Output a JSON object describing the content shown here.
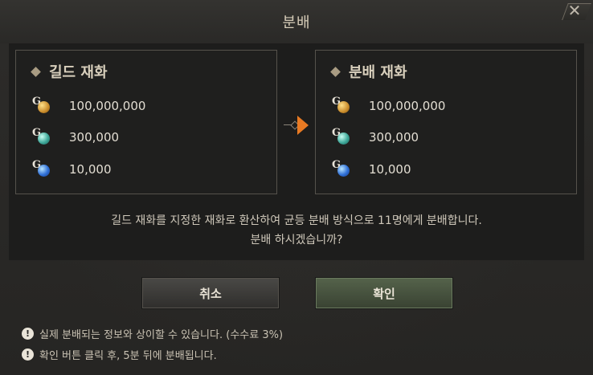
{
  "dialog": {
    "title": "분배",
    "close_label": "✕"
  },
  "guild_currency": {
    "title": "길드 재화",
    "items": [
      {
        "icon": "gold-coin-icon",
        "amount": "100,000,000"
      },
      {
        "icon": "teal-gem-icon",
        "amount": "300,000"
      },
      {
        "icon": "blue-gem-icon",
        "amount": "10,000"
      }
    ]
  },
  "distribute_currency": {
    "title": "분배 재화",
    "items": [
      {
        "icon": "gold-coin-icon",
        "amount": "100,000,000"
      },
      {
        "icon": "teal-gem-icon",
        "amount": "300,000"
      },
      {
        "icon": "blue-gem-icon",
        "amount": "10,000"
      }
    ]
  },
  "message": {
    "line1": "길드 재화를 지정한 재화로 환산하여 균등 분배 방식으로 11명에게 분배합니다.",
    "line2": "분배 하시겠습니까?"
  },
  "buttons": {
    "cancel": "취소",
    "confirm": "확인"
  },
  "notes": [
    "실제 분배되는 정보와 상이할 수 있습니다. (수수료 3%)",
    "확인 버튼 클릭 후, 5분 뒤에 분배됩니다."
  ],
  "colors": {
    "accent_arrow": "#e87a23",
    "confirm_button": "#4b5842"
  }
}
